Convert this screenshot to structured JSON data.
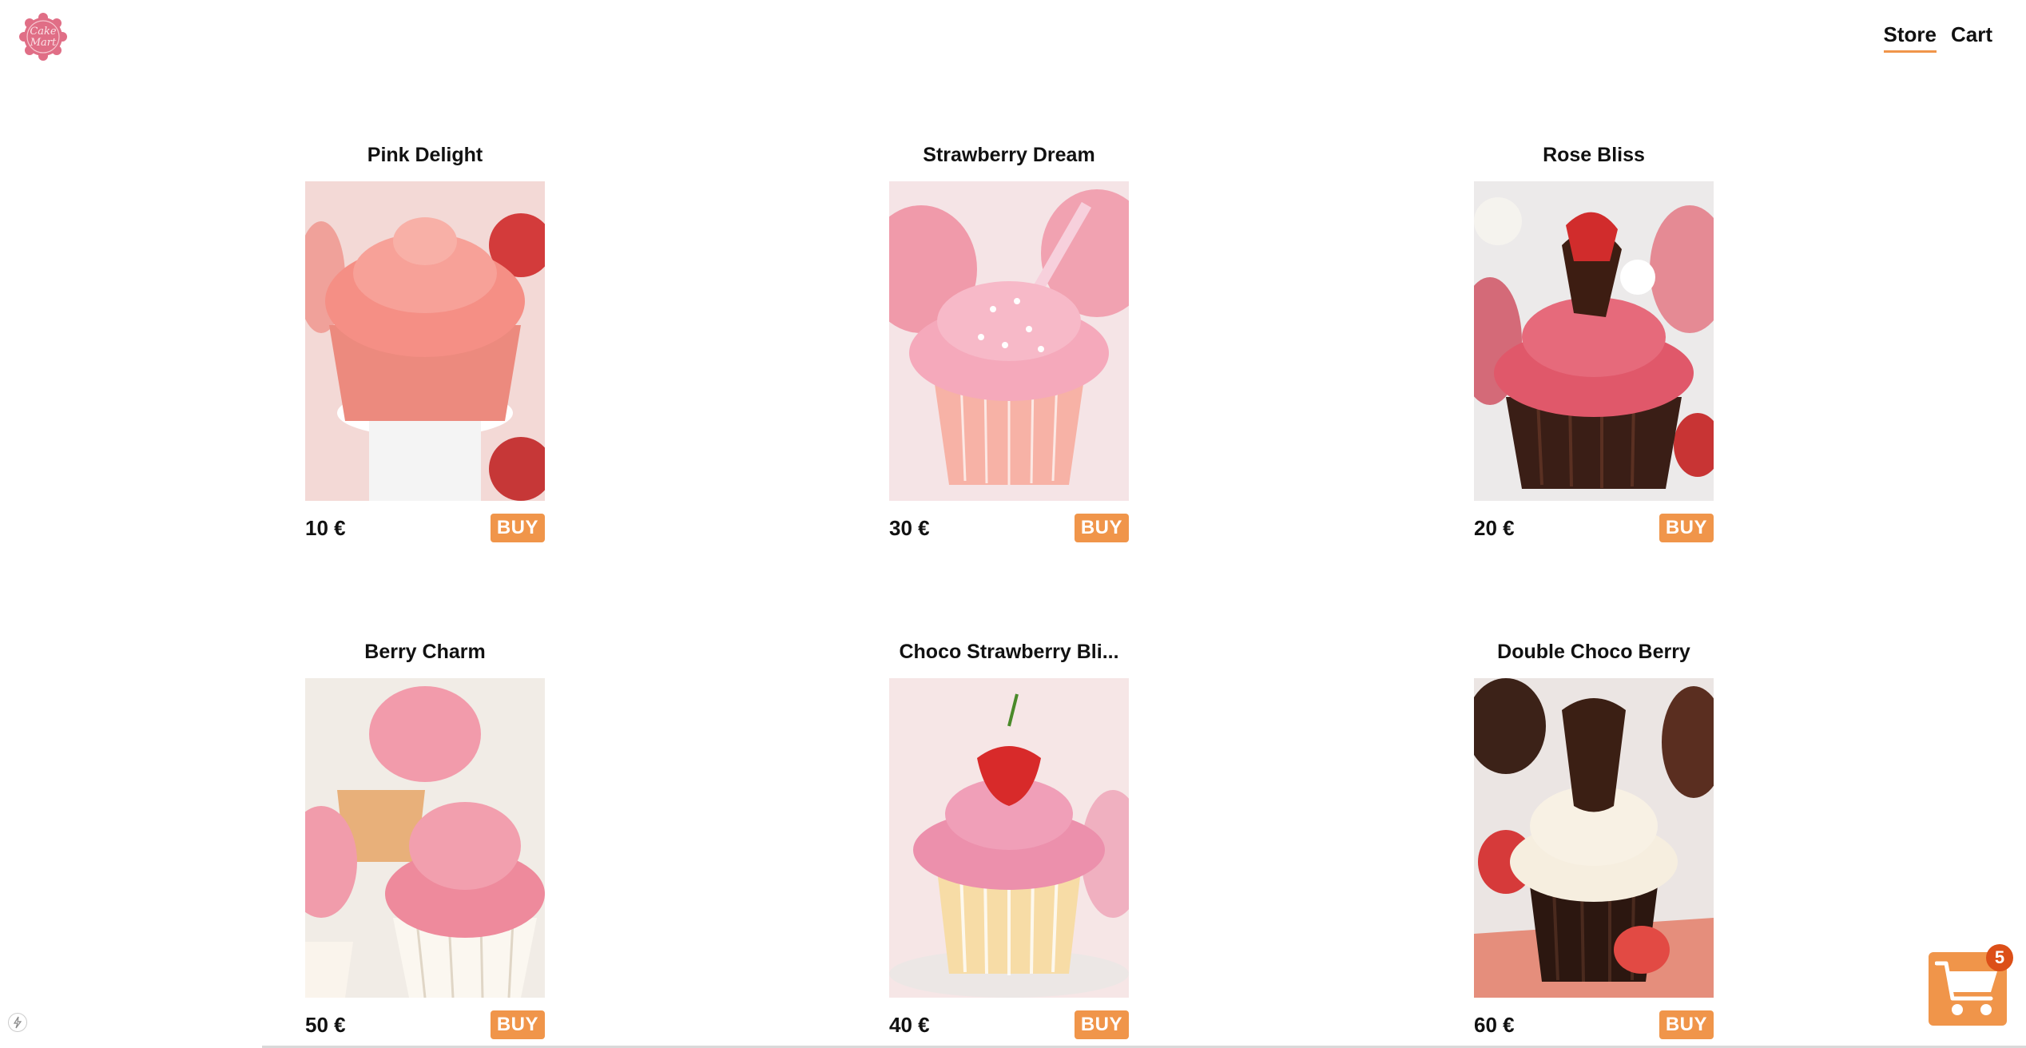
{
  "brand": {
    "logo_text": "Cake Mart",
    "accent_color": "#f0954a",
    "badge_color": "#dc4f18"
  },
  "nav": {
    "items": [
      {
        "label": "Store",
        "active": true
      },
      {
        "label": "Cart",
        "active": false
      }
    ]
  },
  "products": [
    {
      "name": "Pink Delight",
      "price": "10 €",
      "buy_label": "BUY",
      "image_icon": "cupcake-image"
    },
    {
      "name": "Strawberry Dream",
      "price": "30 €",
      "buy_label": "BUY",
      "image_icon": "cupcake-image"
    },
    {
      "name": "Rose Bliss",
      "price": "20 €",
      "buy_label": "BUY",
      "image_icon": "cupcake-image"
    },
    {
      "name": "Berry Charm",
      "price": "50 €",
      "buy_label": "BUY",
      "image_icon": "cupcake-image"
    },
    {
      "name": "Choco Strawberry Bli...",
      "price": "40 €",
      "buy_label": "BUY",
      "image_icon": "cupcake-image"
    },
    {
      "name": "Double Choco Berry",
      "price": "60 €",
      "buy_label": "BUY",
      "image_icon": "cupcake-image"
    }
  ],
  "cart_fab": {
    "icon": "shopping-cart-icon",
    "count": "5"
  }
}
